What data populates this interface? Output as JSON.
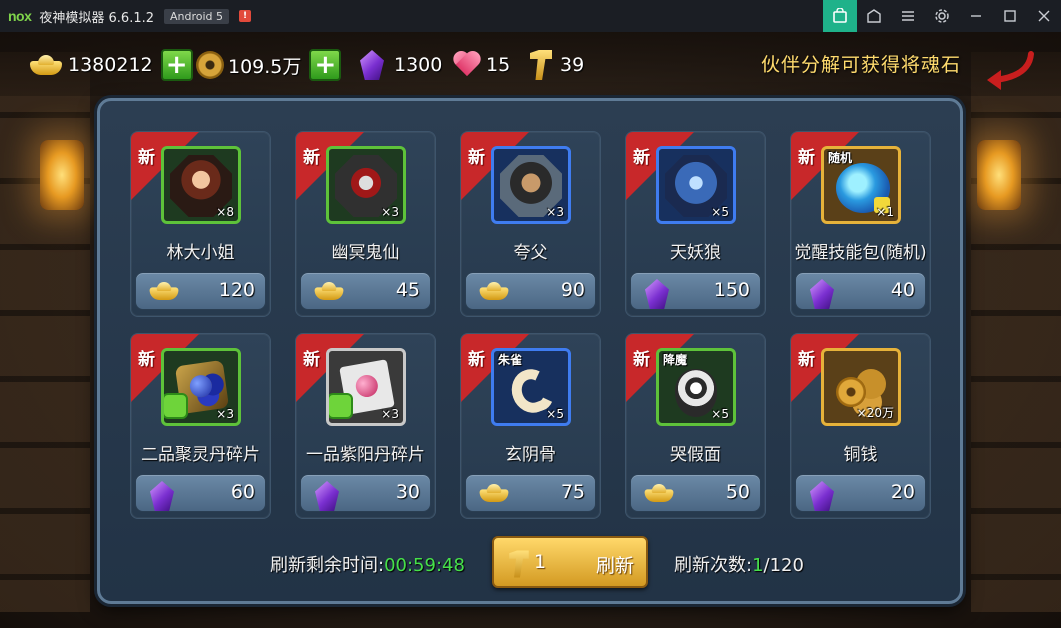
{
  "titlebar": {
    "logo": "nox",
    "title": "夜神模拟器 6.6.1.2",
    "android_badge": "Android 5",
    "warn": "!",
    "buttons": [
      "bag-icon",
      "home-icon",
      "menu-icon",
      "gear-icon",
      "minimize-icon",
      "maximize-icon",
      "close-icon"
    ]
  },
  "resources": {
    "gold": "1380212",
    "coins": "109.5万",
    "gems": "1300",
    "hearts": "15",
    "keys": "39",
    "plus": "+"
  },
  "tip": "伙伴分解可获得将魂石",
  "shop": {
    "new_label": "新",
    "items": [
      {
        "name": "林大小姐",
        "qty": "×8",
        "frame": "green",
        "tag": "",
        "price": "120",
        "currency": "gold"
      },
      {
        "name": "幽冥鬼仙",
        "qty": "×3",
        "frame": "green",
        "tag": "",
        "price": "45",
        "currency": "gold"
      },
      {
        "name": "夸父",
        "qty": "×3",
        "frame": "blue",
        "tag": "",
        "price": "90",
        "currency": "gold"
      },
      {
        "name": "天妖狼",
        "qty": "×5",
        "frame": "blue",
        "tag": "",
        "price": "150",
        "currency": "gem"
      },
      {
        "name": "觉醒技能包(随机)",
        "qty": "×1",
        "frame": "gold",
        "tag": "随机",
        "price": "40",
        "currency": "gem"
      },
      {
        "name": "二品聚灵丹碎片",
        "qty": "×3",
        "frame": "green",
        "tag": "",
        "price": "60",
        "currency": "gem"
      },
      {
        "name": "一品紫阳丹碎片",
        "qty": "×3",
        "frame": "silver",
        "tag": "",
        "price": "30",
        "currency": "gem"
      },
      {
        "name": "玄阴骨",
        "qty": "×5",
        "frame": "blue",
        "tag": "朱雀",
        "price": "75",
        "currency": "gold"
      },
      {
        "name": "哭假面",
        "qty": "×5",
        "frame": "green",
        "tag": "降魔",
        "price": "50",
        "currency": "gold"
      },
      {
        "name": "铜钱",
        "qty": "×20万",
        "frame": "gold",
        "tag": "",
        "price": "20",
        "currency": "gem"
      }
    ]
  },
  "footer": {
    "refresh_time_label": "刷新剩余时间:",
    "refresh_time": "00:59:48",
    "refresh_cost": "1",
    "refresh_button": "刷新",
    "refresh_count_label": "刷新次数:",
    "refresh_count_used": "1",
    "refresh_count_total": "/120"
  },
  "colors": {
    "timer": "#46e04a",
    "new_ribbon": "#c8282a",
    "tip": "#ffdb6e",
    "emulator_accent": "#1fb28a"
  }
}
